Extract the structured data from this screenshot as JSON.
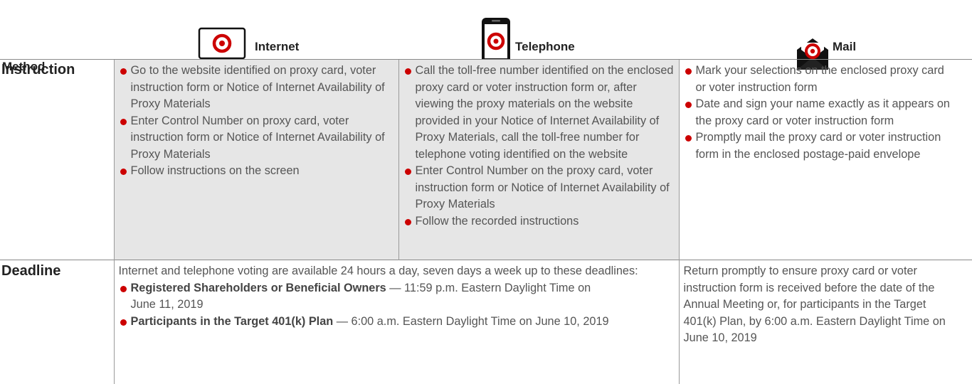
{
  "header": {
    "method_label": "Method",
    "internet_label": "Internet",
    "telephone_label": "Telephone",
    "mail_label": "Mail"
  },
  "icons": {
    "brand_color": "#cc0000",
    "internet": "laptop-icon",
    "telephone": "phone-icon",
    "mail": "envelope-icon"
  },
  "instruction": {
    "label": "Instruction",
    "internet_items": [
      "Go to the website identified on proxy card, voter instruction form or Notice of Internet Availability of Proxy Materials",
      "Enter Control Number on proxy card, voter instruction form or Notice of Internet Availability of Proxy Materials",
      "Follow instructions on the screen"
    ],
    "telephone_items": [
      "Call the toll-free number identified on the enclosed proxy card or voter instruction form or, after viewing the proxy materials on the website provided in your Notice of Internet Availability of Proxy Materials, call the toll-free number for telephone voting identified on the website",
      "Enter Control Number on the proxy card, voter instruction form or Notice of Internet Availability of Proxy Materials",
      "Follow the recorded instructions"
    ],
    "mail_items": [
      "Mark your selections on the enclosed proxy card or voter instruction form",
      "Date and sign your name exactly as it appears on the proxy card or voter instruction form",
      "Promptly mail the proxy card or voter instruction form in the enclosed postage-paid envelope"
    ]
  },
  "deadline": {
    "label": "Deadline",
    "intro": "Internet and telephone voting are available 24 hours a day, seven days a week up to these deadlines:",
    "item1_bold": "Registered Shareholders or Beneficial Owners",
    "item1_text": " — 11:59 p.m. Eastern Daylight Time on June 11, 2019",
    "item2_bold": "Participants in the Target 401(k) Plan",
    "item2_text": " — 6:00 a.m. Eastern Daylight Time on June 10, 2019",
    "mail_text": "Return promptly to ensure proxy card or voter instruction form is received before the date of the Annual Meeting or, for participants in the Target 401(k) Plan, by 6:00 a.m. Eastern Daylight Time on June 10, 2019"
  }
}
